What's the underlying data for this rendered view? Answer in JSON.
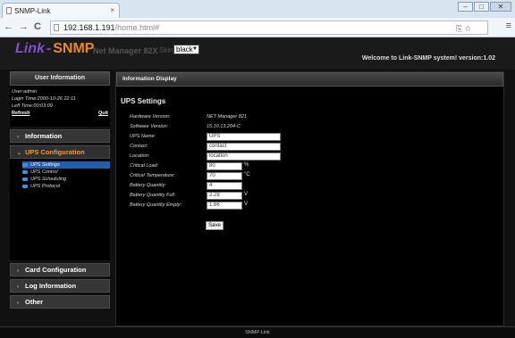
{
  "browser": {
    "tab_title": "SNMP-Link",
    "tab_close": "×",
    "url_host": "192.168.1.191",
    "url_path": "/home.html#",
    "back": "←",
    "forward": "→",
    "reload": "C",
    "url_icons": "⎘ ☆",
    "menu": "≡",
    "win_minimize": "–",
    "win_maximize": "□",
    "win_close": "✕"
  },
  "header": {
    "logo_link": "Link",
    "logo_dash": "-",
    "logo_snmp": "SNMP",
    "product_name": "Net Manager 82X",
    "skin_label": "Skin",
    "skin_value": "black",
    "welcome": "Welcome to Link-SNMP system! version:1.02"
  },
  "sidebar": {
    "user_panel_title": "User Information",
    "user": "User:admin",
    "login_time": "Login Time:2000-10-26 22:11",
    "left_time": "Left Time:00:03:09",
    "refresh": "Refresh",
    "quit": "Quit",
    "sections": {
      "information": "Information",
      "ups_configuration": "UPS Configuration",
      "card_configuration": "Card Configuration",
      "log_information": "Log Information",
      "other": "Other"
    },
    "ups_items": [
      "UPS Settings",
      "UPS Control",
      "UPS Scheduling",
      "UPS Protocol"
    ]
  },
  "content": {
    "panel_title": "Information Display",
    "section_title": "UPS Settings",
    "fields": {
      "hardware_version_label": "Hardware Version:",
      "hardware_version": "NET Manager 821",
      "software_version_label": "Software Version:",
      "software_version": "15.10.13.204-C",
      "ups_name_label": "UPS Name:",
      "ups_name": "UPS",
      "contact_label": "Contact:",
      "contact": "contact",
      "location_label": "Location:",
      "location": "location",
      "critical_load_label": "Critical Load:",
      "critical_load": "80",
      "critical_load_unit": "%",
      "critical_temp_label": "Critical Temperature:",
      "critical_temp": "70",
      "critical_temp_unit": "°C",
      "battery_qty_label": "Battery Quantity:",
      "battery_qty": "4",
      "battery_full_label": "Battery Quantity Full:",
      "battery_full": "2.28",
      "battery_full_unit": "V",
      "battery_empty_label": "Battery Quantity Empty:",
      "battery_empty": "1.66",
      "battery_empty_unit": "V"
    },
    "save_label": "Save"
  },
  "footer": {
    "text": "SNMP-Link"
  }
}
